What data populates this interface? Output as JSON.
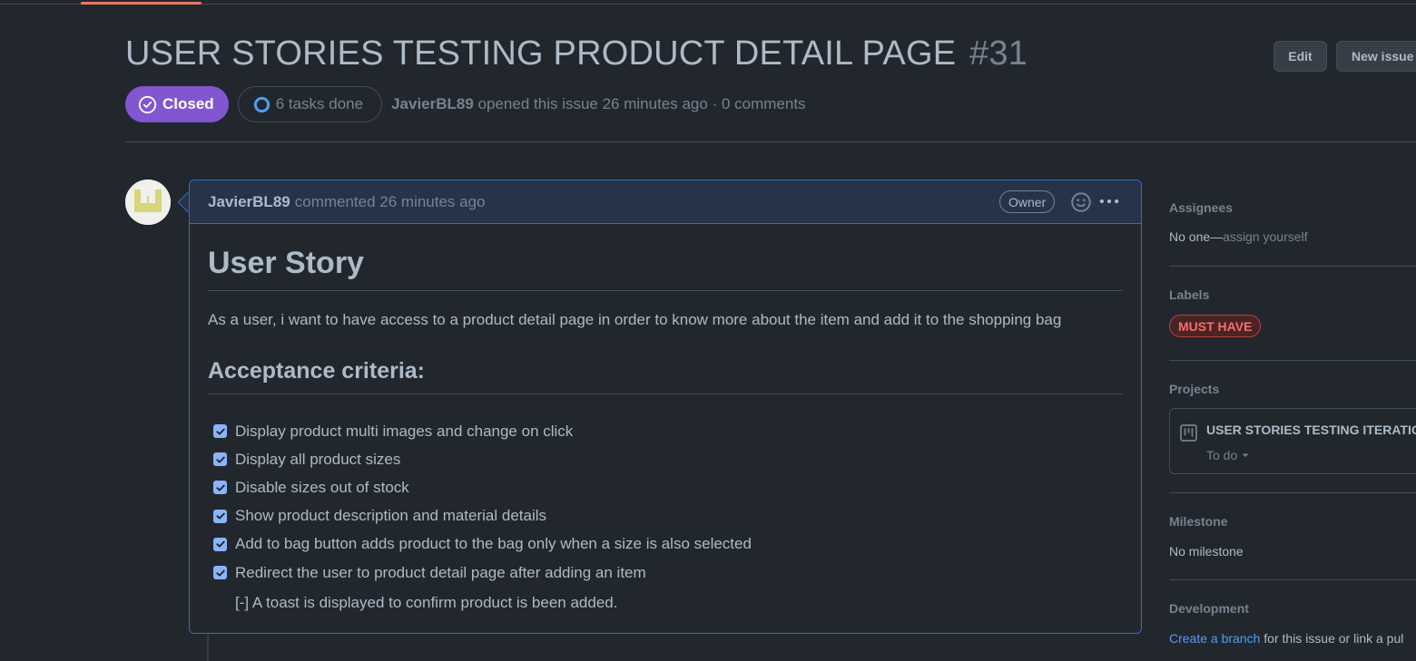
{
  "issue": {
    "title": "USER STORIES TESTING PRODUCT DETAIL PAGE",
    "number": "#31",
    "state": "Closed",
    "tasks": "6 tasks done",
    "author": "JavierBL89",
    "meta": "opened this issue 26 minutes ago · 0 comments"
  },
  "header_buttons": {
    "edit": "Edit",
    "new_issue": "New issue"
  },
  "comment": {
    "author": "JavierBL89",
    "action": "commented 26 minutes ago",
    "role_badge": "Owner",
    "heading": "User Story",
    "story": "As a user, i want to have access to a product detail page in order to know more about the item and add it to the shopping bag",
    "criteria_heading": "Acceptance criteria:",
    "tasks": [
      "Display product multi images and change on click",
      "Display all product sizes",
      "Disable sizes out of stock",
      "Show product description and material details",
      "Add to bag button adds product to the bag only when a size is also selected",
      "Redirect the user to product detail page after adding an item"
    ],
    "extra_line": "[-] A toast is displayed to confirm product is been added."
  },
  "sidebar": {
    "assignees_title": "Assignees",
    "assignees_value": "No one—",
    "assignees_link": "assign yourself",
    "labels_title": "Labels",
    "label": "MUST HAVE",
    "projects_title": "Projects",
    "project_name": "USER STORIES TESTING ITERATION",
    "project_status": "To do",
    "milestone_title": "Milestone",
    "milestone_value": "No milestone",
    "development_title": "Development",
    "development_link": "Create a branch",
    "development_text": " for this issue or link a pul"
  },
  "colors": {
    "background": "#22272e",
    "closed_badge": "#8256d0",
    "accent_blue": "#316dca",
    "label_red": "#f47067",
    "link": "#539bf5"
  }
}
